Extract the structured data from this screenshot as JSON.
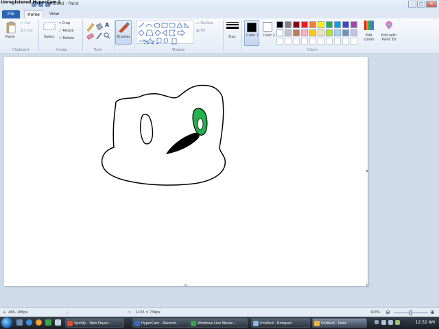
{
  "window": {
    "watermark": "Unregistered HyperCam 2",
    "title": "Untitled - Paint",
    "min": "–",
    "max": "□",
    "close": "✕"
  },
  "tabs": [
    "File",
    "Home",
    "View"
  ],
  "ribbon": {
    "clipboard": {
      "paste": "Paste",
      "cut": "Cut",
      "copy": "Copy",
      "label": "Clipboard"
    },
    "image": {
      "select": "Select",
      "crop": "Crop",
      "resize": "Resize",
      "rotate": "Rotate",
      "label": "Image"
    },
    "tools": {
      "label": "Tools",
      "text_tool": "A"
    },
    "brushes": {
      "label": "Brushes"
    },
    "shapes": {
      "outline": "Outline",
      "fill": "Fill",
      "label": "Shapes"
    },
    "size": {
      "label": "Size"
    },
    "color1": {
      "label": "Color 1"
    },
    "color2": {
      "label": "Color 2"
    },
    "colors": {
      "label": "Colors",
      "row1": [
        "#000000",
        "#7f7f7f",
        "#880015",
        "#ed1c24",
        "#ff7f27",
        "#fff200",
        "#22b14c",
        "#00a2e8",
        "#3f48cc",
        "#a349a4"
      ],
      "row2": [
        "#ffffff",
        "#c3c3c3",
        "#b97a57",
        "#ffaec9",
        "#ffc90e",
        "#efe4b0",
        "#b5e61d",
        "#99d9ea",
        "#7092be",
        "#c8bfe7"
      ],
      "edit_colors": "Edit colors",
      "edit_paint3d": "Edit with Paint 3D"
    }
  },
  "status": {
    "cursor_pos": "466, 188px",
    "canvas_size": "1163 × 734px",
    "zoom": "100%"
  },
  "taskbar": {
    "items": [
      {
        "label": "Spotify - Web Player...",
        "color": "#d94f2f"
      },
      {
        "label": "HyperCam - Recordi...",
        "color": "#3a6cc2"
      },
      {
        "label": "Windows Live Messe...",
        "color": "#3aa54a"
      },
      {
        "label": "Untitled - Notepad",
        "color": "#8fb6e0"
      },
      {
        "label": "Untitled - Paint",
        "color": "#e8b84a"
      }
    ],
    "clock": "12:32 AM"
  }
}
